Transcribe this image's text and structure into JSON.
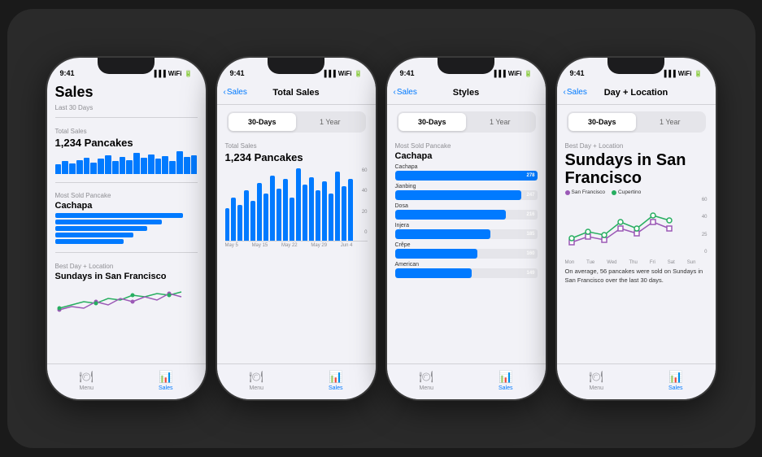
{
  "scene": {
    "bg": "#2a2a2a"
  },
  "phones": [
    {
      "id": "phone1",
      "time": "9:41",
      "screen": "sales_overview",
      "title": "Sales",
      "subtitle": "Last 30 Days",
      "total_sales_label": "Total Sales",
      "total_sales_value": "1,234 Pancakes",
      "most_sold_label": "Most Sold Pancake",
      "most_sold_value": "Cachapa",
      "best_day_label": "Best Day + Location",
      "best_day_value": "Sundays in San Francisco",
      "tab_menu": "Menu",
      "tab_sales": "Sales",
      "active_tab": "sales"
    },
    {
      "id": "phone2",
      "time": "9:41",
      "screen": "total_sales_chart",
      "nav_back": "Sales",
      "nav_title": "Total Sales",
      "segment_options": [
        "30-Days",
        "1 Year"
      ],
      "segment_active": 0,
      "chart_title_label": "Total Sales",
      "chart_title_value": "1,234 Pancakes",
      "chart_x": [
        "May 5",
        "May 15",
        "May 22",
        "May 29",
        "Jun 4"
      ],
      "tab_menu": "Menu",
      "tab_sales": "Sales",
      "active_tab": "sales"
    },
    {
      "id": "phone3",
      "time": "9:41",
      "screen": "styles_chart",
      "nav_back": "Sales",
      "nav_title": "Styles",
      "segment_options": [
        "30-Days",
        "1 Year"
      ],
      "segment_active": 0,
      "chart_title_label": "Most Sold Pancake",
      "chart_title_value": "Cachapa",
      "bars": [
        {
          "name": "Cachapa",
          "value": 278,
          "pct": 100
        },
        {
          "name": "Jianbing",
          "value": 247,
          "pct": 89
        },
        {
          "name": "Dosa",
          "value": 216,
          "pct": 78
        },
        {
          "name": "Injera",
          "value": 185,
          "pct": 67
        },
        {
          "name": "Crêpe",
          "value": 160,
          "pct": 58
        },
        {
          "name": "American",
          "value": 149,
          "pct": 54
        }
      ],
      "tab_menu": "Menu",
      "tab_sales": "Sales",
      "active_tab": "sales"
    },
    {
      "id": "phone4",
      "time": "9:41",
      "screen": "day_location",
      "nav_back": "Sales",
      "nav_title": "Day + Location",
      "segment_options": [
        "30-Days",
        "1 Year"
      ],
      "segment_active": 0,
      "chart_title_label": "Best Day + Location",
      "chart_title_value": "Sundays in San Francisco",
      "legend_sf": "San Francisco",
      "legend_cupertino": "Cupertino",
      "color_sf": "#9b59b6",
      "color_cupertino": "#27ae60",
      "desc_text": "On average, 56 pancakes were sold on Sundays in San Francisco over the last 30 days.",
      "chart_x": [
        "Mon",
        "Tue",
        "Wed",
        "Thu",
        "Fri",
        "Sat",
        "Sun"
      ],
      "tab_menu": "Menu",
      "tab_sales": "Sales",
      "active_tab": "sales"
    }
  ]
}
